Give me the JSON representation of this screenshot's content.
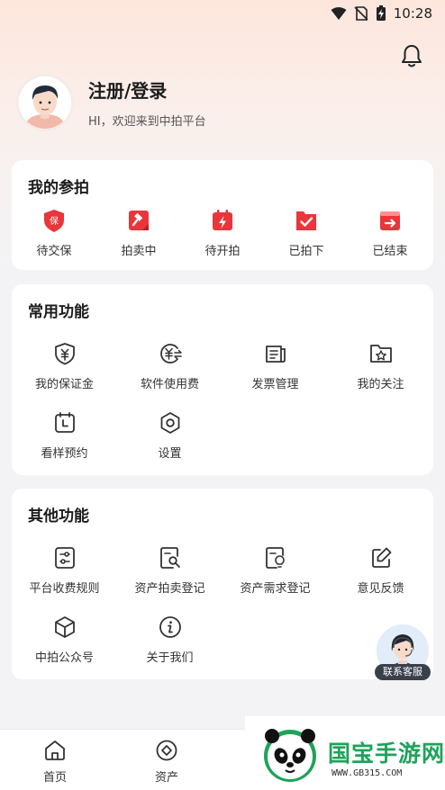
{
  "status_bar": {
    "time": "10:28"
  },
  "profile": {
    "title": "注册/登录",
    "welcome": "HI，欢迎来到中拍平台"
  },
  "my_bids": {
    "title": "我的参拍",
    "items": [
      {
        "label": "待交保",
        "icon": "deposit-shield-icon",
        "badge": "保"
      },
      {
        "label": "拍卖中",
        "icon": "gavel-icon"
      },
      {
        "label": "待开拍",
        "icon": "calendar-bolt-icon"
      },
      {
        "label": "已拍下",
        "icon": "check-folder-icon"
      },
      {
        "label": "已结束",
        "icon": "exit-box-icon"
      }
    ]
  },
  "common": {
    "title": "常用功能",
    "items": [
      {
        "label": "我的保证金",
        "icon": "yuan-shield-icon"
      },
      {
        "label": "软件使用费",
        "icon": "yuan-exchange-icon"
      },
      {
        "label": "发票管理",
        "icon": "invoice-icon"
      },
      {
        "label": "我的关注",
        "icon": "star-folder-icon"
      },
      {
        "label": "看样预约",
        "icon": "calendar-clock-icon"
      },
      {
        "label": "设置",
        "icon": "settings-icon"
      }
    ]
  },
  "other": {
    "title": "其他功能",
    "items": [
      {
        "label": "平台收费规则",
        "icon": "rules-sliders-icon"
      },
      {
        "label": "资产拍卖登记",
        "icon": "doc-search-icon"
      },
      {
        "label": "资产需求登记",
        "icon": "doc-bulb-icon"
      },
      {
        "label": "意见反馈",
        "icon": "feedback-edit-icon"
      },
      {
        "label": "中拍公众号",
        "icon": "cube-icon"
      },
      {
        "label": "关于我们",
        "icon": "info-icon"
      }
    ]
  },
  "customer_service": {
    "label": "联系客服"
  },
  "bottom_nav": [
    {
      "label": "首页",
      "icon": "home-icon"
    },
    {
      "label": "资产",
      "icon": "asset-diamond-icon"
    }
  ],
  "watermark": {
    "text": "国宝手游网",
    "url": "WWW.GB315.COM"
  },
  "colors": {
    "accent_red": "#e8363a",
    "text_dark": "#222222",
    "card_bg": "#ffffff"
  }
}
